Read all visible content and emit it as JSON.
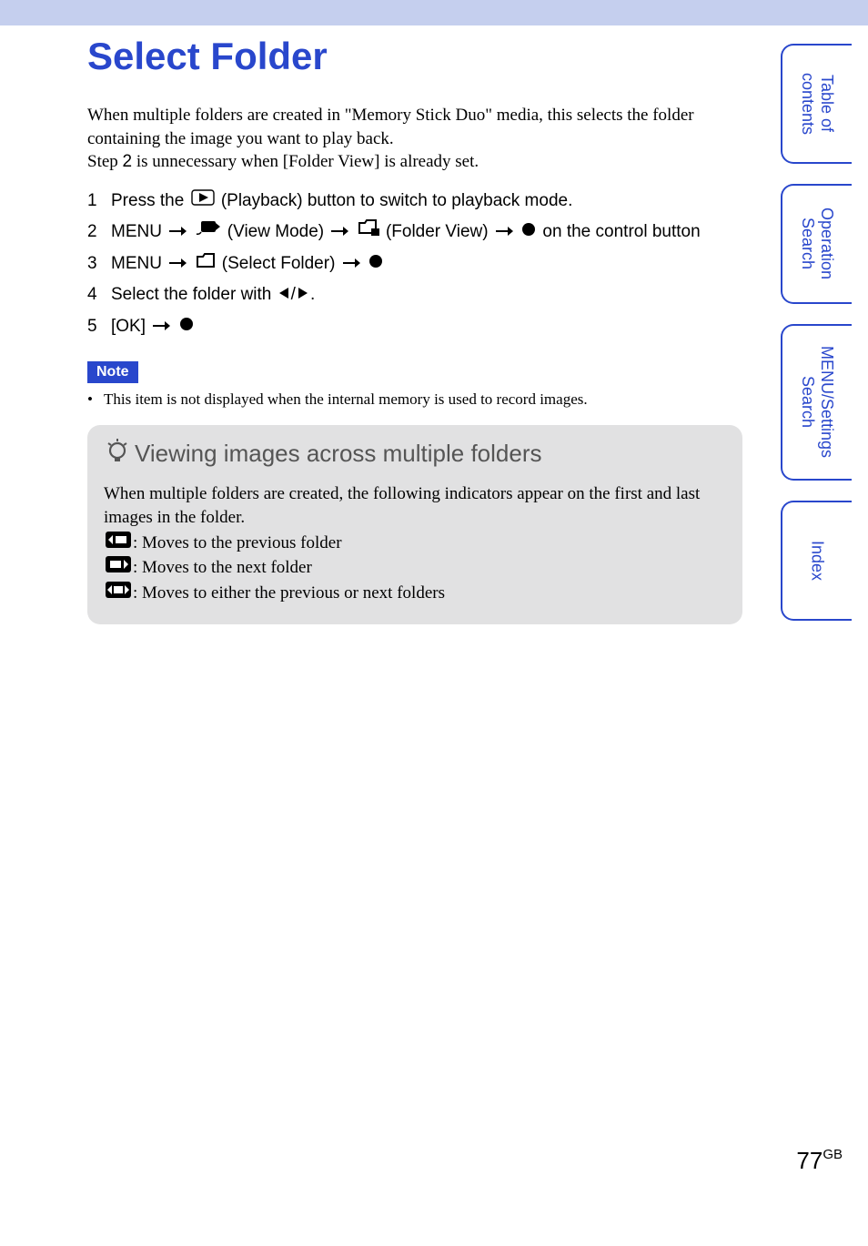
{
  "title": "Select Folder",
  "intro_line1": "When multiple folders are created in \"Memory Stick Duo\" media, this selects the folder containing the image you want to play back.",
  "intro_line2_a": "Step ",
  "intro_line2_num": "2",
  "intro_line2_b": " is unnecessary when [Folder View] is already set.",
  "steps": [
    {
      "num": "1",
      "text_a": "Press the ",
      "text_b": " (Playback) button to switch to playback mode."
    },
    {
      "num": "2",
      "text_a": "MENU ",
      "text_b": " (View Mode) ",
      "text_c": " (Folder View) ",
      "text_d": " on the control button"
    },
    {
      "num": "3",
      "text_a": "MENU ",
      "text_b": " (Select Folder) "
    },
    {
      "num": "4",
      "text_a": "Select the folder with ",
      "text_b": "."
    },
    {
      "num": "5",
      "text_a": "[OK] "
    }
  ],
  "note_label": "Note",
  "note_item": "This item is not displayed when the internal memory is used to record images.",
  "tip_title": "Viewing images across multiple folders",
  "tip_intro": "When multiple folders are created, the following indicators appear on the first and last images in the folder.",
  "tip_lines": [
    ": Moves to the previous folder",
    ": Moves to the next folder",
    ": Moves to either the previous or next folders"
  ],
  "side_tabs": [
    "Table of\ncontents",
    "Operation\nSearch",
    "MENU/Settings\nSearch",
    "Index"
  ],
  "page_number": "77",
  "page_suffix": "GB"
}
